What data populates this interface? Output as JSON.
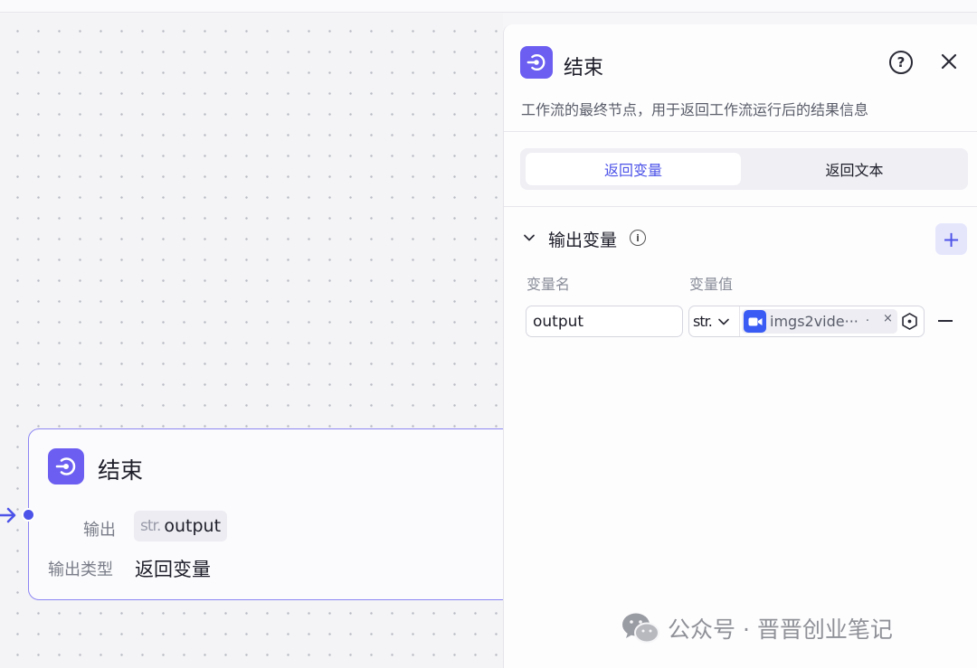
{
  "node": {
    "title": "结束",
    "output_label": "输出",
    "output_chip_type": "str.",
    "output_chip_value": "output",
    "type_label": "输出类型",
    "type_value": "返回变量"
  },
  "panel": {
    "title": "结束",
    "description": "工作流的最终节点，用于返回工作流运行后的结果信息",
    "help_symbol": "?",
    "tabs": [
      {
        "label": "返回变量",
        "active": true
      },
      {
        "label": "返回文本",
        "active": false
      }
    ],
    "section": {
      "title": "输出变量",
      "info_symbol": "i",
      "add_symbol": "+",
      "col_name": "变量名",
      "col_value": "变量值"
    },
    "row": {
      "name": "output",
      "type": "str.",
      "reference": "imgs2vide···",
      "ref_separator": "·",
      "remove_symbol": "×"
    }
  },
  "watermark": {
    "text": "公众号 · 晋晋创业笔记"
  },
  "colors": {
    "accent": "#4d53e8",
    "node_icon": "#6b5ef0",
    "video_icon": "#3a5cf5"
  }
}
